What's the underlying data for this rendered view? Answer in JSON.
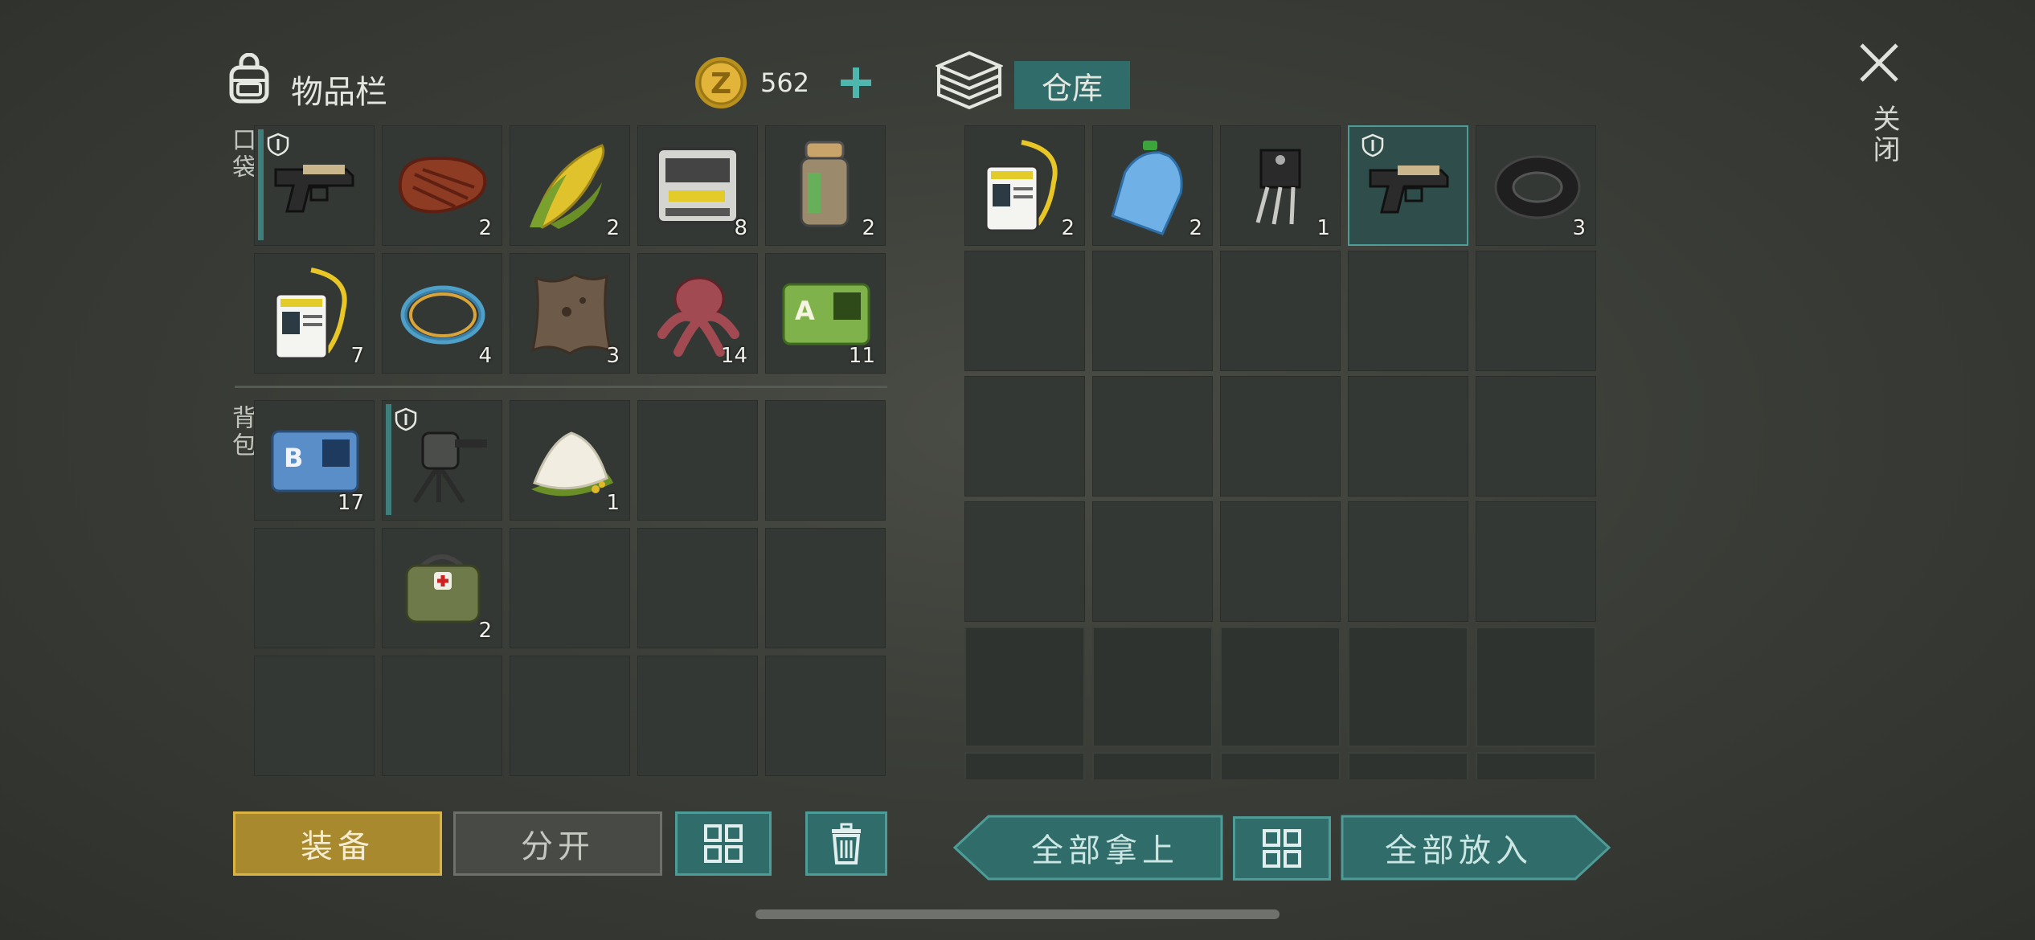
{
  "inventory": {
    "title": "物品栏",
    "currency": {
      "icon": "z-coin-icon",
      "amount": "562",
      "add_icon": "plus-icon"
    },
    "pockets_label": "口袋",
    "backpack_label": "背包",
    "pockets": [
      {
        "item": "pistol",
        "count": "",
        "protected": true,
        "equipped": true
      },
      {
        "item": "steak",
        "count": "2"
      },
      {
        "item": "corn",
        "count": "2"
      },
      {
        "item": "electronic-device",
        "count": "8"
      },
      {
        "item": "canister",
        "count": "2"
      },
      {
        "item": "id-badge",
        "count": "7"
      },
      {
        "item": "wire-coil",
        "count": "4"
      },
      {
        "item": "animal-hide",
        "count": "3"
      },
      {
        "item": "mushroom-creature",
        "count": "14"
      },
      {
        "item": "sector-a-card",
        "count": "11"
      }
    ],
    "backpack": [
      {
        "item": "sector-b-card",
        "count": "17"
      },
      {
        "item": "mounted-turret",
        "count": "",
        "protected": true,
        "equipped": true
      },
      {
        "item": "flour",
        "count": "1"
      },
      null,
      null,
      null,
      {
        "item": "medkit-bag",
        "count": "2"
      },
      null,
      null,
      null,
      null,
      null,
      null,
      null,
      null
    ],
    "buttons": {
      "equip": "装备",
      "split": "分开"
    }
  },
  "storage": {
    "title": "仓库",
    "icon": "storage-box-icon",
    "slots": [
      {
        "item": "id-badge",
        "count": "2"
      },
      {
        "item": "water-bottle",
        "count": "2"
      },
      {
        "item": "transistor",
        "count": "1"
      },
      {
        "item": "pistol",
        "count": "",
        "protected": true,
        "selected": true
      },
      {
        "item": "rubber-tire",
        "count": "3"
      }
    ],
    "buttons": {
      "take_all": "全部拿上",
      "put_all": "全部放入"
    }
  },
  "close": {
    "label": "关闭",
    "icon": "close-icon"
  },
  "colors": {
    "accent_teal": "#4e9c97",
    "equip_gold": "#a8892d",
    "background": "#3b3e38"
  }
}
